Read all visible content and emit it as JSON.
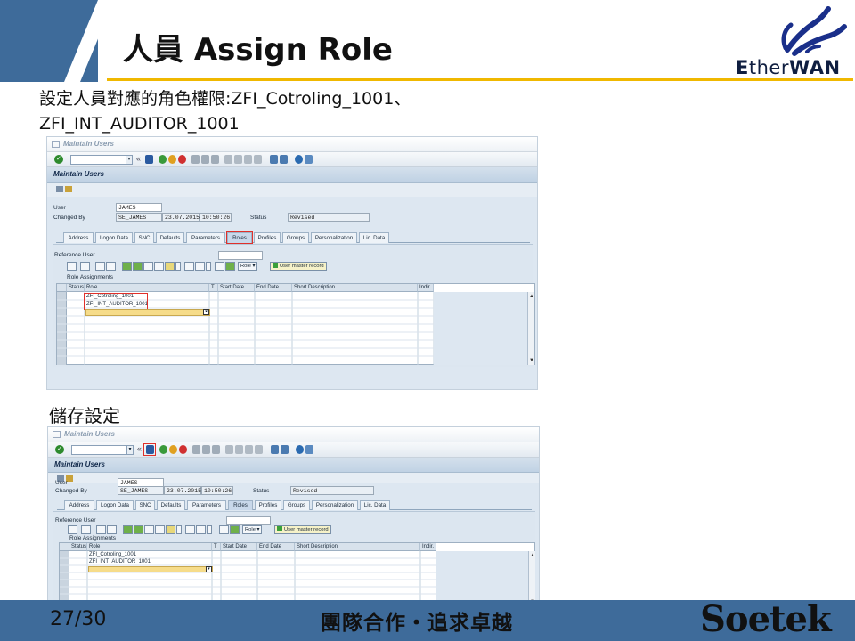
{
  "slide": {
    "title": "人員 Assign Role",
    "description_line1": "設定人員對應的角色權限:ZFI_Cotroling_1001、",
    "description_line2": "ZFI_INT_AUDITOR_1001",
    "caption_save": "儲存設定",
    "page_number": "27/30",
    "motto": "團隊合作・追求卓越",
    "brand": "Soetek",
    "logo": {
      "text_light": "E",
      "text_mid": "ther",
      "text_bold": "WAN"
    },
    "colors": {
      "banner": "#3e6b9a",
      "accent_line": "#f0b800",
      "highlight_red": "#e0302a"
    }
  },
  "sap": {
    "window_title": "Maintain Users",
    "screen_title": "Maintain Users",
    "fields": {
      "user_label": "User",
      "user_value": "JAMES",
      "changed_by_label": "Changed By",
      "changed_by_value": "SE_JAMES",
      "changed_date": "23.07.2015",
      "changed_time": "10:50:26",
      "status_label": "Status",
      "status_value": "Revised"
    },
    "tabs": [
      "Address",
      "Logon Data",
      "SNC",
      "Defaults",
      "Parameters",
      "Roles",
      "Profiles",
      "Groups",
      "Personalization",
      "Lic. Data"
    ],
    "active_tab": "Roles",
    "reference_user_label": "Reference User",
    "role_assignments_label": "Role Assignments",
    "role_button_label": "Role",
    "user_master_record_label": "User master record",
    "columns": [
      "Status",
      "Role",
      "T",
      "Start Date",
      "End Date",
      "Short Description",
      "Indir."
    ],
    "roles": [
      "ZFI_Cotroling_1001",
      "ZFI_INT_AUDITOR_1001"
    ]
  }
}
